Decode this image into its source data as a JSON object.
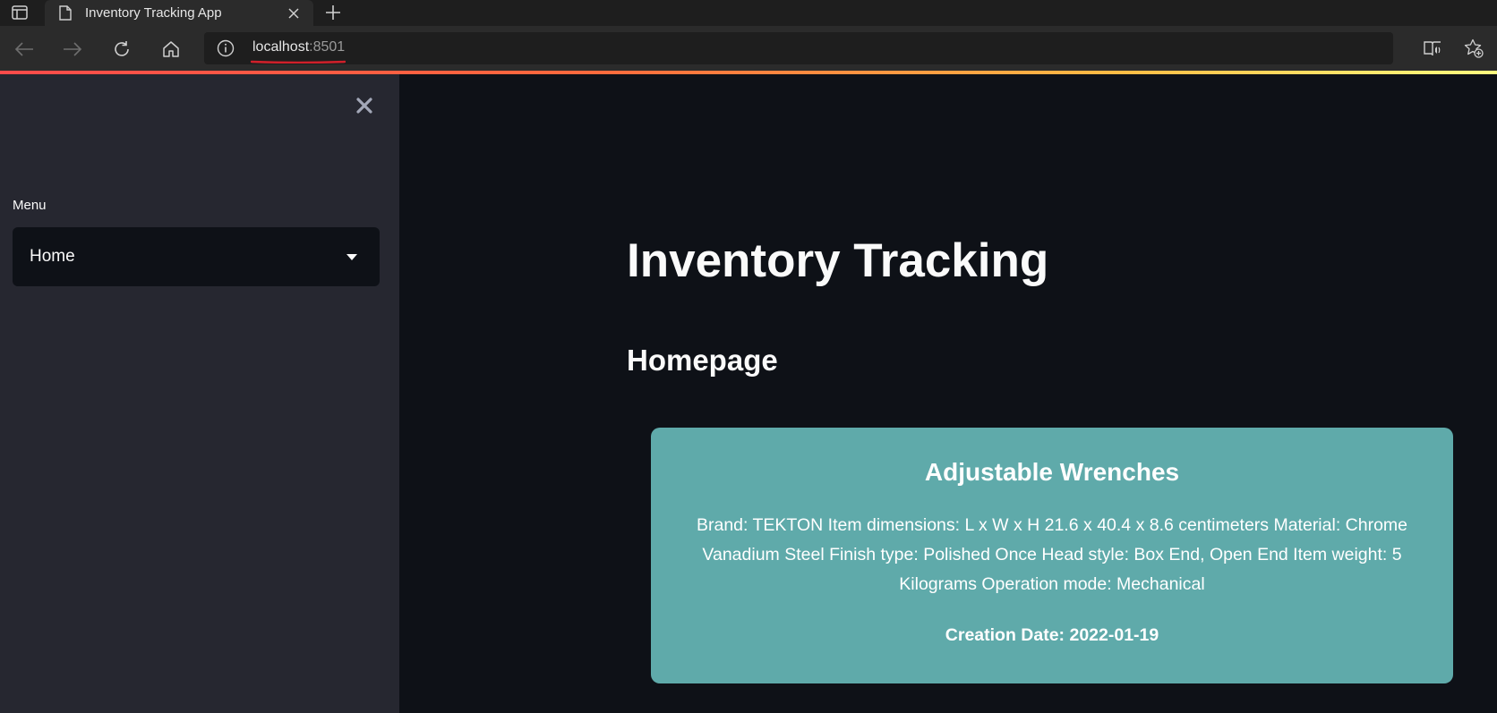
{
  "browser": {
    "tab_title": "Inventory Tracking App",
    "url_host": "localhost",
    "url_port": ":8501"
  },
  "sidebar": {
    "menu_label": "Menu",
    "menu_selected": "Home"
  },
  "main": {
    "title": "Inventory Tracking",
    "subtitle": "Homepage",
    "card": {
      "name": "Adjustable Wrenches",
      "description": "Brand: TEKTON Item dimensions: L x W x H 21.6 x 40.4 x 8.6 centimeters Material: Chrome Vanadium Steel Finish type: Polished Once Head style: Box End, Open End Item weight: 5 Kilograms Operation mode: Mechanical",
      "creation_date": "Creation Date: 2022-01-19"
    }
  },
  "colors": {
    "page_bg": "#0e1117",
    "sidebar_bg": "#262730",
    "card_bg": "#5faaaa",
    "accent": "#ff4b4b"
  },
  "icons": {
    "tab_actions": "tab-actions-icon",
    "page": "page-icon",
    "close": "close-icon",
    "new_tab": "plus-icon",
    "back": "back-arrow-icon",
    "forward": "forward-arrow-icon",
    "refresh": "refresh-icon",
    "home": "home-icon",
    "info": "info-icon",
    "reader": "immersive-reader-icon",
    "favorite": "add-favorite-icon",
    "dropdown": "chevron-down-icon"
  }
}
